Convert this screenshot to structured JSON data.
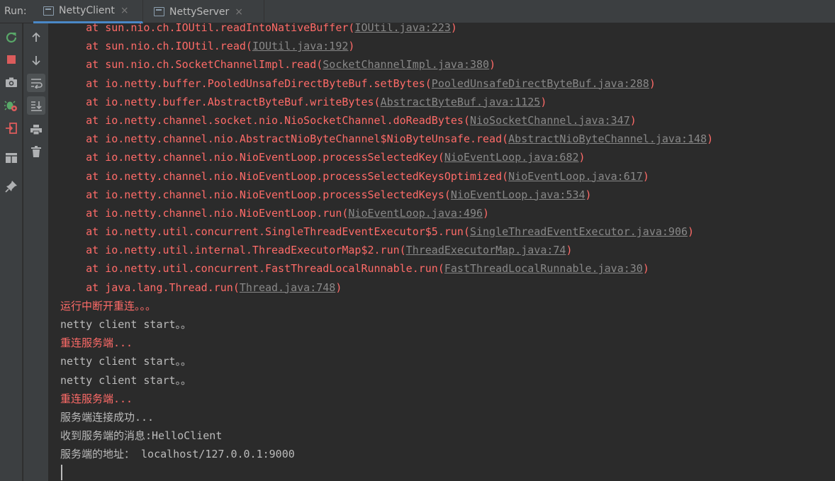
{
  "run_bar": {
    "label": "Run:",
    "tabs": [
      {
        "label": "NettyClient",
        "close": "×"
      },
      {
        "label": "NettyServer",
        "close": "×"
      }
    ]
  },
  "toolbar": {
    "left_icons": [
      "rerun-icon",
      "stop-icon",
      "camera-icon",
      "debug-settings-icon",
      "exit-icon",
      "layout-icon",
      "pin-icon"
    ],
    "right_icons": [
      "arrow-up-icon",
      "arrow-down-icon",
      "soft-wrap-icon",
      "scroll-to-end-icon",
      "print-icon",
      "trash-icon"
    ]
  },
  "colors": {
    "error_red": "#ff6b68",
    "normal_text": "#bbbbbb",
    "link": "#888888",
    "background": "#2b2b2b"
  },
  "console": {
    "stack": [
      {
        "pre": "    at sun.nio.ch.IOUtil.readIntoNativeBuffer(",
        "link": "IOUtil.java:223",
        "post": ")"
      },
      {
        "pre": "    at sun.nio.ch.IOUtil.read(",
        "link": "IOUtil.java:192",
        "post": ")"
      },
      {
        "pre": "    at sun.nio.ch.SocketChannelImpl.read(",
        "link": "SocketChannelImpl.java:380",
        "post": ")"
      },
      {
        "pre": "    at io.netty.buffer.PooledUnsafeDirectByteBuf.setBytes(",
        "link": "PooledUnsafeDirectByteBuf.java:288",
        "post": ")"
      },
      {
        "pre": "    at io.netty.buffer.AbstractByteBuf.writeBytes(",
        "link": "AbstractByteBuf.java:1125",
        "post": ")"
      },
      {
        "pre": "    at io.netty.channel.socket.nio.NioSocketChannel.doReadBytes(",
        "link": "NioSocketChannel.java:347",
        "post": ")"
      },
      {
        "pre": "    at io.netty.channel.nio.AbstractNioByteChannel$NioByteUnsafe.read(",
        "link": "AbstractNioByteChannel.java:148",
        "post": ")"
      },
      {
        "pre": "    at io.netty.channel.nio.NioEventLoop.processSelectedKey(",
        "link": "NioEventLoop.java:682",
        "post": ")"
      },
      {
        "pre": "    at io.netty.channel.nio.NioEventLoop.processSelectedKeysOptimized(",
        "link": "NioEventLoop.java:617",
        "post": ")"
      },
      {
        "pre": "    at io.netty.channel.nio.NioEventLoop.processSelectedKeys(",
        "link": "NioEventLoop.java:534",
        "post": ")"
      },
      {
        "pre": "    at io.netty.channel.nio.NioEventLoop.run(",
        "link": "NioEventLoop.java:496",
        "post": ")"
      },
      {
        "pre": "    at io.netty.util.concurrent.SingleThreadEventExecutor$5.run(",
        "link": "SingleThreadEventExecutor.java:906",
        "post": ")"
      },
      {
        "pre": "    at io.netty.util.internal.ThreadExecutorMap$2.run(",
        "link": "ThreadExecutorMap.java:74",
        "post": ")"
      },
      {
        "pre": "    at io.netty.util.concurrent.FastThreadLocalRunnable.run(",
        "link": "FastThreadLocalRunnable.java:30",
        "post": ")"
      },
      {
        "pre": "    at java.lang.Thread.run(",
        "link": "Thread.java:748",
        "post": ")"
      }
    ],
    "messages": [
      {
        "text": "运行中断开重连。。。",
        "level": "error"
      },
      {
        "text": "netty client start。。",
        "level": "info"
      },
      {
        "text": "重连服务端...",
        "level": "error"
      },
      {
        "text": "netty client start。。",
        "level": "info"
      },
      {
        "text": "netty client start。。",
        "level": "info"
      },
      {
        "text": "重连服务端...",
        "level": "error"
      },
      {
        "text": "服务端连接成功...",
        "level": "info"
      },
      {
        "text": "收到服务端的消息:HelloClient",
        "level": "info"
      },
      {
        "text": "服务端的地址： localhost/127.0.0.1:9000",
        "level": "info"
      }
    ]
  }
}
